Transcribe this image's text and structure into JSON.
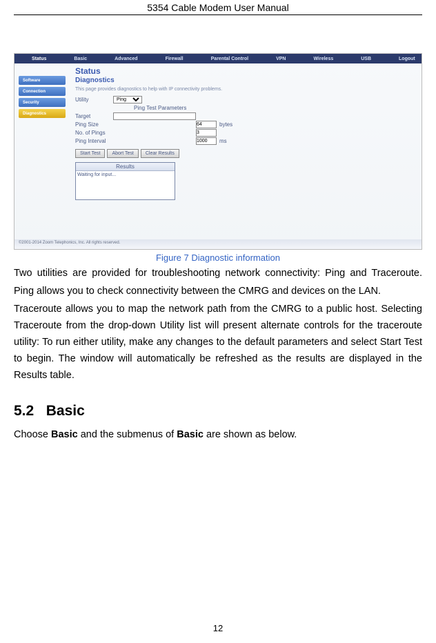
{
  "header": {
    "title": "5354 Cable Modem User Manual"
  },
  "figure": {
    "nav": [
      "Status",
      "Basic",
      "Advanced",
      "Firewall",
      "Parental Control",
      "VPN",
      "Wireless",
      "USB",
      "Logout"
    ],
    "sidebar": [
      {
        "label": "Software",
        "style": "blue"
      },
      {
        "label": "Connection",
        "style": "blue"
      },
      {
        "label": "Security",
        "style": "blue"
      },
      {
        "label": "Diagnostics",
        "style": "yellow"
      }
    ],
    "panel_title": "Status",
    "panel_subtitle": "Diagnostics",
    "panel_desc": "This page provides diagnostics to help with IP connectivity problems.",
    "utility_label": "Utility",
    "utility_value": "Ping",
    "params_title": "Ping Test Parameters",
    "rows": {
      "target_label": "Target",
      "target_value": "",
      "pingsize_label": "Ping Size",
      "pingsize_value": "64",
      "pingsize_unit": "bytes",
      "nopings_label": "No. of Pings",
      "nopings_value": "3",
      "interval_label": "Ping Interval",
      "interval_value": "1000",
      "interval_unit": "ms"
    },
    "buttons": [
      "Start Test",
      "Abort Test",
      "Clear Results"
    ],
    "results_header": "Results",
    "results_body": "Waiting for input...",
    "copyright": "©2001-2014 Zoom Telephonics, Inc. All rights reserved."
  },
  "caption": "Figure 7 Diagnostic information",
  "paragraphs": {
    "p1": "Two utilities are provided for troubleshooting network connectivity: Ping and Traceroute.",
    "p2": "Ping allows you to check connectivity between the CMRG and devices on the LAN.",
    "p3": "Traceroute allows you to map the network path from the CMRG to a public host. Selecting Traceroute from the drop-down Utility list will present alternate controls for the traceroute utility: To run either utility, make any changes to the default parameters and select Start Test to begin.   The window will automatically be refreshed as the results are displayed in the Results table."
  },
  "section": {
    "number": "5.2",
    "title": "Basic"
  },
  "basic_sentence": {
    "prefix": "Choose ",
    "bold1": "Basic",
    "mid": " and the submenus of ",
    "bold2": "Basic",
    "suffix": " are shown as below."
  },
  "page_number": "12"
}
